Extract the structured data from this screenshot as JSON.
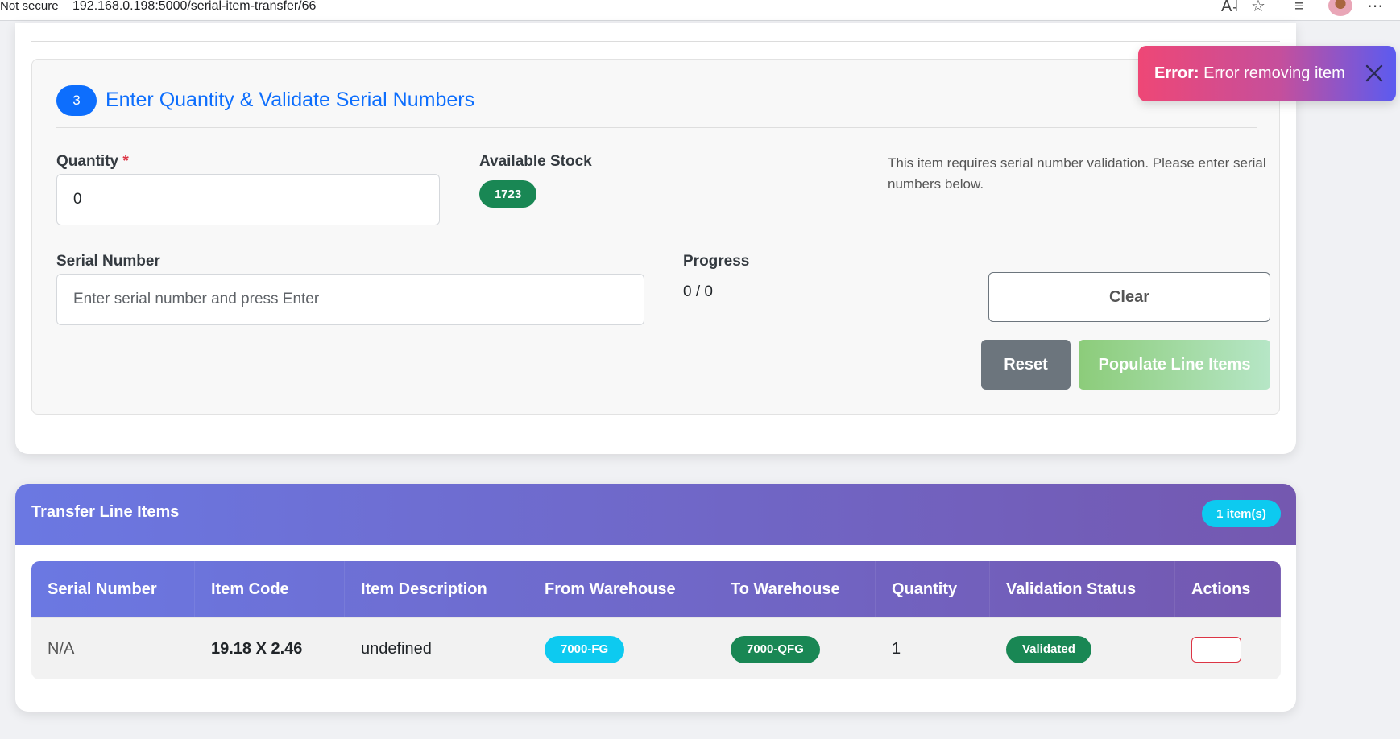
{
  "browser": {
    "security": "Not secure",
    "url": "192.168.0.198:5000/serial-item-transfer/66"
  },
  "step": {
    "number": "3",
    "title": "Enter Quantity & Validate Serial Numbers",
    "quantity_label": "Quantity",
    "required_mark": "*",
    "quantity_value": "0",
    "available_stock_label": "Available Stock",
    "available_stock_value": "1723",
    "info_text": "This item requires serial number validation. Please enter serial numbers below.",
    "serial_label": "Serial Number",
    "serial_placeholder": "Enter serial number and press Enter",
    "progress_label": "Progress",
    "progress_value": "0 / 0",
    "clear_label": "Clear",
    "reset_label": "Reset",
    "populate_label": "Populate Line Items"
  },
  "toast": {
    "prefix": "Error:",
    "message": "Error removing item"
  },
  "line_items": {
    "title": "Transfer Line Items",
    "count_badge": "1 item(s)",
    "columns": [
      "Serial Number",
      "Item Code",
      "Item Description",
      "From Warehouse",
      "To Warehouse",
      "Quantity",
      "Validation Status",
      "Actions"
    ],
    "rows": [
      {
        "serial_number": "N/A",
        "item_code": "19.18 X 2.46",
        "item_description": "undefined",
        "from_warehouse": "7000-FG",
        "to_warehouse": "7000-QFG",
        "quantity": "1",
        "validation_status": "Validated"
      }
    ]
  },
  "colors": {
    "primary": "#0d6efd",
    "success": "#198754",
    "info": "#0dcaf0",
    "danger": "#dc3545",
    "secondary": "#6c757d"
  }
}
